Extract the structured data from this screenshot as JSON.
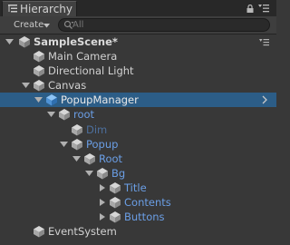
{
  "window": {
    "tab_title": "Hierarchy"
  },
  "toolbar": {
    "create_label": "Create",
    "search_placeholder": "All"
  },
  "scene": {
    "name": "SampleScene*"
  },
  "tree": [
    {
      "label": "Main Camera",
      "depth": 1,
      "arrow": "none",
      "style": "dark",
      "cube": "gray"
    },
    {
      "label": "Directional Light",
      "depth": 1,
      "arrow": "none",
      "style": "dark",
      "cube": "gray"
    },
    {
      "label": "Canvas",
      "depth": 1,
      "arrow": "down",
      "style": "dark",
      "cube": "gray"
    },
    {
      "label": "PopupManager",
      "depth": 2,
      "arrow": "down",
      "style": "white",
      "cube": "blue",
      "selected": true
    },
    {
      "label": "root",
      "depth": 3,
      "arrow": "down",
      "style": "blue",
      "cube": "gray"
    },
    {
      "label": "Dim",
      "depth": 4,
      "arrow": "none",
      "style": "dim",
      "cube": "gray"
    },
    {
      "label": "Popup",
      "depth": 4,
      "arrow": "down",
      "style": "blue",
      "cube": "gray"
    },
    {
      "label": "Root",
      "depth": 5,
      "arrow": "down",
      "style": "blue",
      "cube": "gray"
    },
    {
      "label": "Bg",
      "depth": 6,
      "arrow": "down",
      "style": "blue",
      "cube": "gray"
    },
    {
      "label": "Title",
      "depth": 7,
      "arrow": "right",
      "style": "blue",
      "cube": "gray"
    },
    {
      "label": "Contents",
      "depth": 7,
      "arrow": "right",
      "style": "blue",
      "cube": "gray"
    },
    {
      "label": "Buttons",
      "depth": 7,
      "arrow": "right",
      "style": "blue",
      "cube": "gray"
    },
    {
      "label": "EventSystem",
      "depth": 1,
      "arrow": "none",
      "style": "dark",
      "cube": "gray"
    }
  ],
  "icons": {
    "tab": "hierarchy-list-icon",
    "lock": "lock-icon",
    "menu": "panel-menu-icon",
    "search": "search-icon",
    "scene": "unity-scene-icon",
    "object": "gameobject-cube-icon"
  },
  "colors": {
    "background": "#383838",
    "selection": "#2c5d87",
    "prefab_text": "#6b9fe6",
    "inactive_text": "#4d6f9c",
    "text": "#d2d2d2"
  }
}
